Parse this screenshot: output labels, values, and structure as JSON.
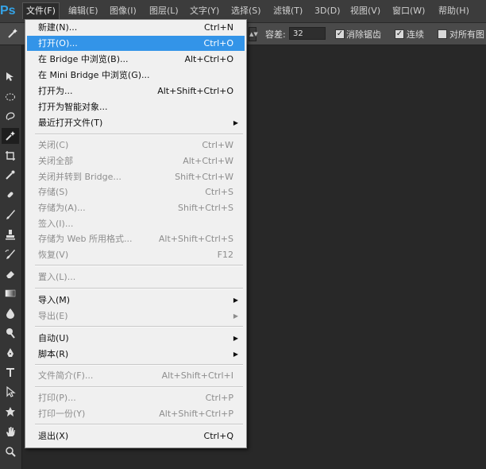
{
  "app": {
    "logo": "Ps"
  },
  "menubar": {
    "items": [
      "文件(F)",
      "编辑(E)",
      "图像(I)",
      "图层(L)",
      "文字(Y)",
      "选择(S)",
      "滤镜(T)",
      "3D(D)",
      "视图(V)",
      "窗口(W)",
      "帮助(H)"
    ]
  },
  "options": {
    "tolerance_label": "容差:",
    "tolerance_value": "32",
    "antialias_label": "消除锯齿",
    "contiguous_label": "连续",
    "all_layers_label": "对所有图"
  },
  "file_menu": {
    "items": [
      {
        "label": "新建(N)...",
        "shortcut": "Ctrl+N"
      },
      {
        "label": "打开(O)...",
        "shortcut": "Ctrl+O"
      },
      {
        "label": "在 Bridge 中浏览(B)...",
        "shortcut": "Alt+Ctrl+O"
      },
      {
        "label": "在 Mini Bridge 中浏览(G)...",
        "shortcut": ""
      },
      {
        "label": "打开为...",
        "shortcut": "Alt+Shift+Ctrl+O"
      },
      {
        "label": "打开为智能对象...",
        "shortcut": ""
      },
      {
        "label": "最近打开文件(T)",
        "shortcut": "",
        "submenu": true
      },
      {
        "label": "关闭(C)",
        "shortcut": "Ctrl+W"
      },
      {
        "label": "关闭全部",
        "shortcut": "Alt+Ctrl+W"
      },
      {
        "label": "关闭并转到 Bridge...",
        "shortcut": "Shift+Ctrl+W"
      },
      {
        "label": "存储(S)",
        "shortcut": "Ctrl+S"
      },
      {
        "label": "存储为(A)...",
        "shortcut": "Shift+Ctrl+S"
      },
      {
        "label": "签入(I)...",
        "shortcut": ""
      },
      {
        "label": "存储为 Web 所用格式...",
        "shortcut": "Alt+Shift+Ctrl+S"
      },
      {
        "label": "恢复(V)",
        "shortcut": "F12"
      },
      {
        "label": "置入(L)...",
        "shortcut": ""
      },
      {
        "label": "导入(M)",
        "shortcut": "",
        "submenu": true
      },
      {
        "label": "导出(E)",
        "shortcut": "",
        "submenu": true
      },
      {
        "label": "自动(U)",
        "shortcut": "",
        "submenu": true
      },
      {
        "label": "脚本(R)",
        "shortcut": "",
        "submenu": true
      },
      {
        "label": "文件简介(F)...",
        "shortcut": "Alt+Shift+Ctrl+I"
      },
      {
        "label": "打印(P)...",
        "shortcut": "Ctrl+P"
      },
      {
        "label": "打印一份(Y)",
        "shortcut": "Alt+Shift+Ctrl+P"
      },
      {
        "label": "退出(X)",
        "shortcut": "Ctrl+Q"
      }
    ],
    "submenu_arrow": "▶"
  }
}
